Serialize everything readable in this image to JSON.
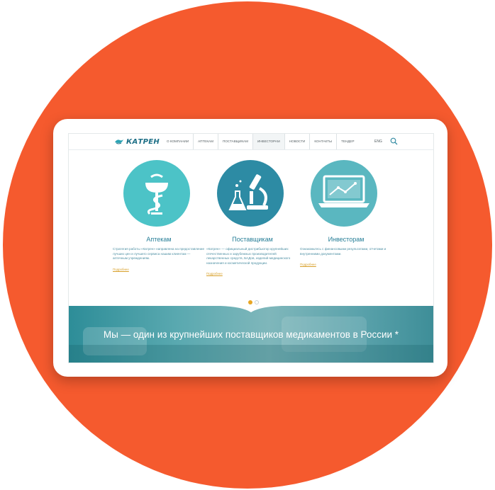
{
  "colors": {
    "background_circle": "#f55a2e",
    "accent_teal": "#267e97",
    "link_gold": "#d8a02a",
    "pagination_active": "#e8a624"
  },
  "logo": {
    "text": "КАТРЕН",
    "icon": "katren-bird-logo-icon"
  },
  "nav": {
    "items": [
      {
        "label": "О компании"
      },
      {
        "label": "Аптекам"
      },
      {
        "label": "Поставщикам"
      },
      {
        "label": "Инвесторам"
      },
      {
        "label": "Новости"
      },
      {
        "label": "Контакты"
      },
      {
        "label": "Тендер"
      }
    ],
    "language": "ENG",
    "search_icon": "search-icon"
  },
  "cards": [
    {
      "icon": "pharmacy-bowl-of-hygieia-icon",
      "color": "#4cc3c7",
      "title": "Аптекам",
      "description": "Стратегия работы «Катрен» направлена на предоставление лучших цен и лучшего сервиса нашим клиентам — аптечным учреждениям.",
      "link": "Подробнее"
    },
    {
      "icon": "microscope-flask-icon",
      "color": "#2d8ba4",
      "title": "Поставщикам",
      "description": "«Катрен» — официальный дистрибьютор крупнейших отечественных и зарубежных производителей лекарственных средств, БАДов, изделий медицинского назначения и косметической продукции.",
      "link": "Подробнее"
    },
    {
      "icon": "laptop-chart-icon",
      "color": "#5ab7c0",
      "title": "Инвесторам",
      "description": "Ознакомьтесь с финансовыми результатами, отчетами и внутренними документами.",
      "link": "Подробнее"
    }
  ],
  "pagination": {
    "total": 2,
    "active_index": 0
  },
  "banner": {
    "text": "Мы — один из крупнейших поставщиков медикаментов в России *"
  }
}
